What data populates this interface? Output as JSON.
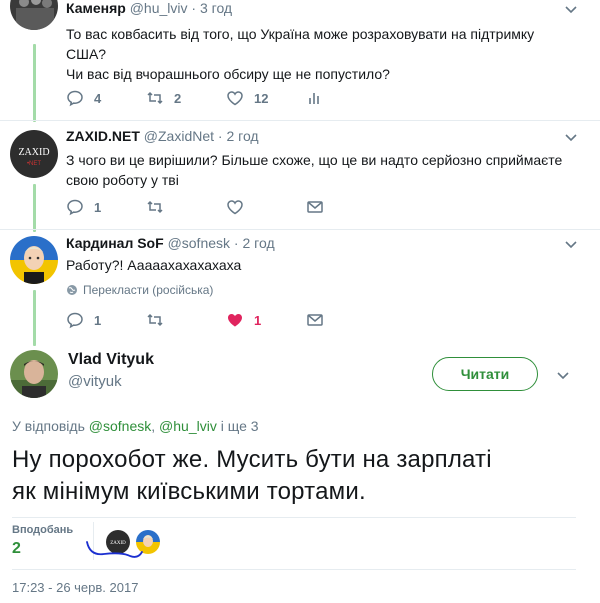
{
  "colors": {
    "accent": "#2f8f3a",
    "muted": "#657786",
    "like": "#e0245e",
    "thread": "#a3dba8"
  },
  "tweets": [
    {
      "name": "Каменяр",
      "handle": "@hu_lviv",
      "time": "3 год",
      "lines": [
        "То вас ковбасить від того, що Україна може розраховувати на підтримку",
        "США?",
        "Чи вас від вчорашнього обсиру ще не попустило?"
      ],
      "replies": "4",
      "retweets": "2",
      "likes": "12"
    },
    {
      "name": "ZAXID.NET",
      "handle": "@ZaxidNet",
      "time": "2 год",
      "avatar_text": "ZAXID",
      "avatar_sub": "•NET",
      "lines": [
        "З чого ви це вирішили? Більше схоже, що це ви надто серйозно сприймаєте",
        "свою роботу у тві"
      ],
      "replies": "1"
    },
    {
      "name": "Кардинал SoF",
      "handle": "@sofnesk",
      "time": "2 год",
      "lines": [
        "Работу?! Аааааxахахахаха"
      ],
      "translate": "Перекласти (російська)",
      "replies": "1",
      "likes": "1"
    }
  ],
  "main": {
    "name": "Vlad Vityuk",
    "handle": "@vityuk",
    "follow_label": "Читати",
    "reply_prefix": "У відповідь",
    "mention1": "@sofnesk",
    "mention2": "@hu_lviv",
    "reply_suffix": "і ще 3",
    "text_line1": "Ну порохобот же. Мусить бути на зарплаті",
    "text_line2": "як мінімум київськими тортами.",
    "likes_label": "Вподобань",
    "likes_count": "2",
    "liker_avatar_text": "ZAXID",
    "timestamp": "17:23 - 26 черв. 2017"
  }
}
